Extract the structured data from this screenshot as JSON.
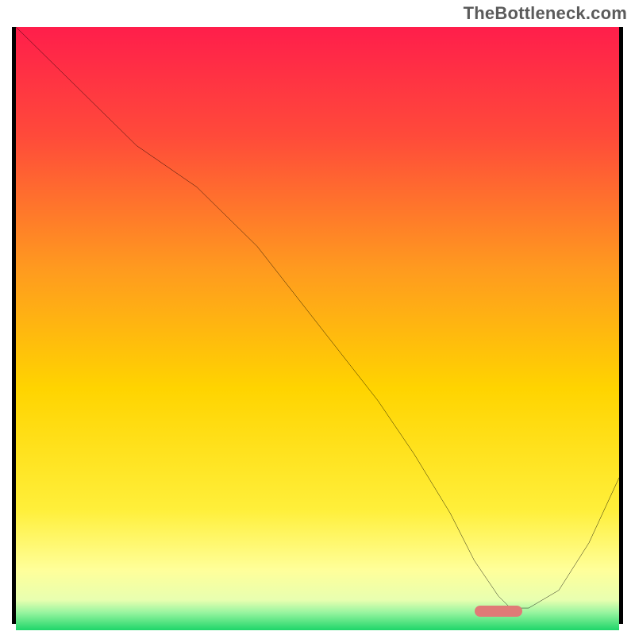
{
  "watermark": "TheBottleneck.com",
  "chart_data": {
    "type": "line",
    "title": "",
    "xlabel": "",
    "ylabel": "",
    "xlim": [
      0,
      100
    ],
    "ylim": [
      0,
      100
    ],
    "grid": false,
    "legend": false,
    "background_gradient": {
      "top_color": "#ff1e4b",
      "mid_color": "#ffd400",
      "low_color": "#ffff8a",
      "bottom_color": "#1fd66a"
    },
    "series": [
      {
        "name": "bottleneck-curve",
        "stroke": "#000000",
        "stroke_width": 3,
        "x": [
          0,
          10,
          20,
          30,
          40,
          50,
          60,
          66,
          72,
          76,
          80,
          82,
          85,
          90,
          95,
          100
        ],
        "y": [
          100,
          90,
          80,
          73,
          63,
          50,
          37,
          28,
          18,
          10,
          4,
          2,
          2,
          5,
          13,
          24
        ]
      }
    ],
    "marker": {
      "name": "optimal-range",
      "color": "#e07a77",
      "x_start": 76,
      "x_end": 84,
      "y": 1.5,
      "height_pct": 1.8
    }
  }
}
